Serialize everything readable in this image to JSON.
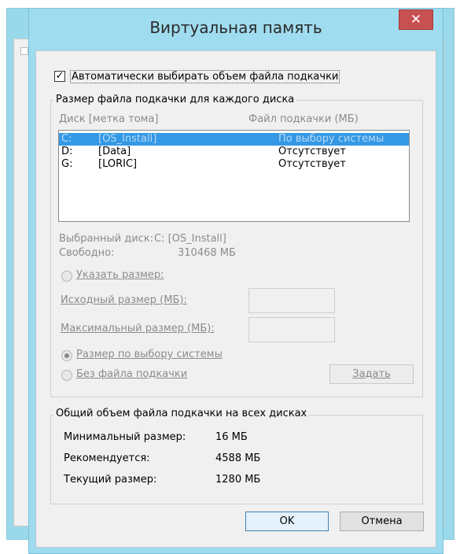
{
  "dialog": {
    "title": "Виртуальная память",
    "close_glyph": "✕"
  },
  "auto_checkbox": {
    "checked": true,
    "label": "Автоматически выбирать объем файла подкачки"
  },
  "paging_group": {
    "title": "Размер файла подкачки для каждого диска",
    "col_disk": "Диск [метка тома]",
    "col_file": "Файл подкачки (МБ)",
    "drives": [
      {
        "drive": "C:",
        "label": "[OS_Install]",
        "file": "По выбору системы",
        "selected": true
      },
      {
        "drive": "D:",
        "label": "[Data]",
        "file": "Отсутствует",
        "selected": false
      },
      {
        "drive": "G:",
        "label": "[LORIC]",
        "file": "Отсутствует",
        "selected": false
      }
    ],
    "selected_disk_label": "Выбранный диск:",
    "selected_disk_value": "C:  [OS_Install]",
    "free_label": "Свободно:",
    "free_value": "310468 МБ",
    "custom_size_label": "Указать размер:",
    "initial_size_label": "Исходный размер (МБ):",
    "max_size_label": "Максимальный размер (МБ):",
    "system_managed_label": "Размер по выбору системы",
    "no_paging_label": "Без файла подкачки",
    "set_button": "Задать",
    "selected_option": "system_managed"
  },
  "total_group": {
    "title": "Общий объем файла подкачки на всех дисках",
    "min_label": "Минимальный размер:",
    "min_value": "16 МБ",
    "recommended_label": "Рекомендуется:",
    "recommended_value": "4588 МБ",
    "current_label": "Текущий размер:",
    "current_value": "1280 МБ"
  },
  "buttons": {
    "ok": "OK",
    "cancel": "Отмена"
  }
}
